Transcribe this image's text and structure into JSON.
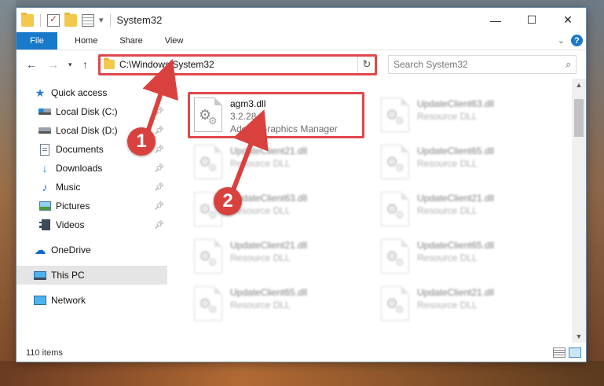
{
  "window": {
    "title": "System32",
    "controls": {
      "minimize": "—",
      "maximize": "☐",
      "close": "✕"
    }
  },
  "ribbon": {
    "tabs": [
      "File",
      "Home",
      "Share",
      "View"
    ],
    "help": "?"
  },
  "navigation": {
    "address": "C:\\Windows\\System32",
    "search_placeholder": "Search System32"
  },
  "sidebar": {
    "items": [
      {
        "label": "Quick access",
        "icon": "star-icon",
        "pinned": false
      },
      {
        "label": "Local Disk (C:)",
        "icon": "disk-icon",
        "pinned": true
      },
      {
        "label": "Local Disk (D:)",
        "icon": "disk-icon",
        "pinned": true
      },
      {
        "label": "Documents",
        "icon": "documents-icon",
        "pinned": true
      },
      {
        "label": "Downloads",
        "icon": "downloads-icon",
        "pinned": true
      },
      {
        "label": "Music",
        "icon": "music-icon",
        "pinned": true
      },
      {
        "label": "Pictures",
        "icon": "pictures-icon",
        "pinned": true
      },
      {
        "label": "Videos",
        "icon": "videos-icon",
        "pinned": true
      },
      {
        "label": "OneDrive",
        "icon": "onedrive-icon",
        "pinned": false
      },
      {
        "label": "This PC",
        "icon": "this-pc-icon",
        "pinned": false,
        "selected": true
      },
      {
        "label": "Network",
        "icon": "network-icon",
        "pinned": false
      }
    ]
  },
  "files": [
    {
      "name": "agm3.dll",
      "line2": "3.2.28.1",
      "line3": "Adobe Graphics Manager",
      "blurred": false
    },
    {
      "name": "UpdateClient63.dll",
      "line2": "Resource DLL",
      "blurred": true
    },
    {
      "name": "UpdateClient21.dll",
      "line2": "Resource DLL",
      "blurred": true
    },
    {
      "name": "UpdateClient65.dll",
      "line2": "Resource DLL",
      "blurred": true
    },
    {
      "name": "UpdateClient63.dll",
      "line2": "Resource DLL",
      "blurred": true
    },
    {
      "name": "UpdateClient21.dll",
      "line2": "Resource DLL",
      "blurred": true
    },
    {
      "name": "UpdateClient21.dll",
      "line2": "Resource DLL",
      "blurred": true
    },
    {
      "name": "UpdateClient65.dll",
      "line2": "Resource DLL",
      "blurred": true
    },
    {
      "name": "UpdateClient65.dll",
      "line2": "Resource DLL",
      "blurred": true
    },
    {
      "name": "UpdateClient21.dll",
      "line2": "Resource DLL",
      "blurred": true
    }
  ],
  "status": {
    "item_count": "110 items"
  },
  "annotations": {
    "step1": "1",
    "step2": "2",
    "color": "#d9413f"
  }
}
